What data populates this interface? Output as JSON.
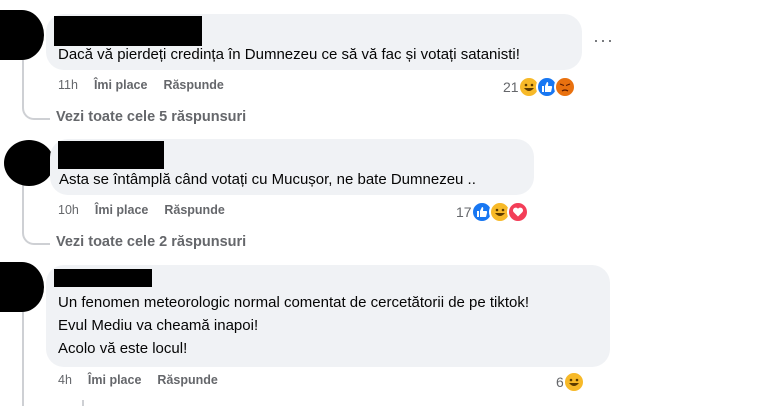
{
  "colors": {
    "bubble": "#f0f2f5",
    "secondary_text": "#65676b",
    "like_blue": "#1877f2",
    "haha_yellow": "#f7b928",
    "angry_red": "#e9710f",
    "love_red": "#f33e58"
  },
  "comments": [
    {
      "text": "Dacă vă pierdeți credința în Dumnezeu ce să vă fac și votați satanisti!",
      "time": "11h",
      "like_label": "Îmi place",
      "reply_label": "Răspunde",
      "reaction_count": "21",
      "reaction_icons": [
        "haha-icon",
        "like-icon",
        "angry-icon"
      ],
      "view_replies": "Vezi toate cele 5 răspunsuri",
      "more_icon": "more-options-icon"
    },
    {
      "text": "Asta se întâmplă când votați cu Mucușor, ne bate Dumnezeu ..",
      "time": "10h",
      "like_label": "Îmi place",
      "reply_label": "Răspunde",
      "reaction_count": "17",
      "reaction_icons": [
        "like-icon",
        "haha-icon",
        "love-icon"
      ],
      "view_replies": "Vezi toate cele 2 răspunsuri"
    },
    {
      "lines": [
        "Un fenomen meteorologic normal comentat de cercetătorii de pe tiktok!",
        "Evul Mediu va cheamă inapoi!",
        "Acolo vă este locul!"
      ],
      "time": "4h",
      "like_label": "Îmi place",
      "reply_label": "Răspunde",
      "reaction_count": "6",
      "reaction_icons": [
        "haha-icon"
      ]
    }
  ]
}
